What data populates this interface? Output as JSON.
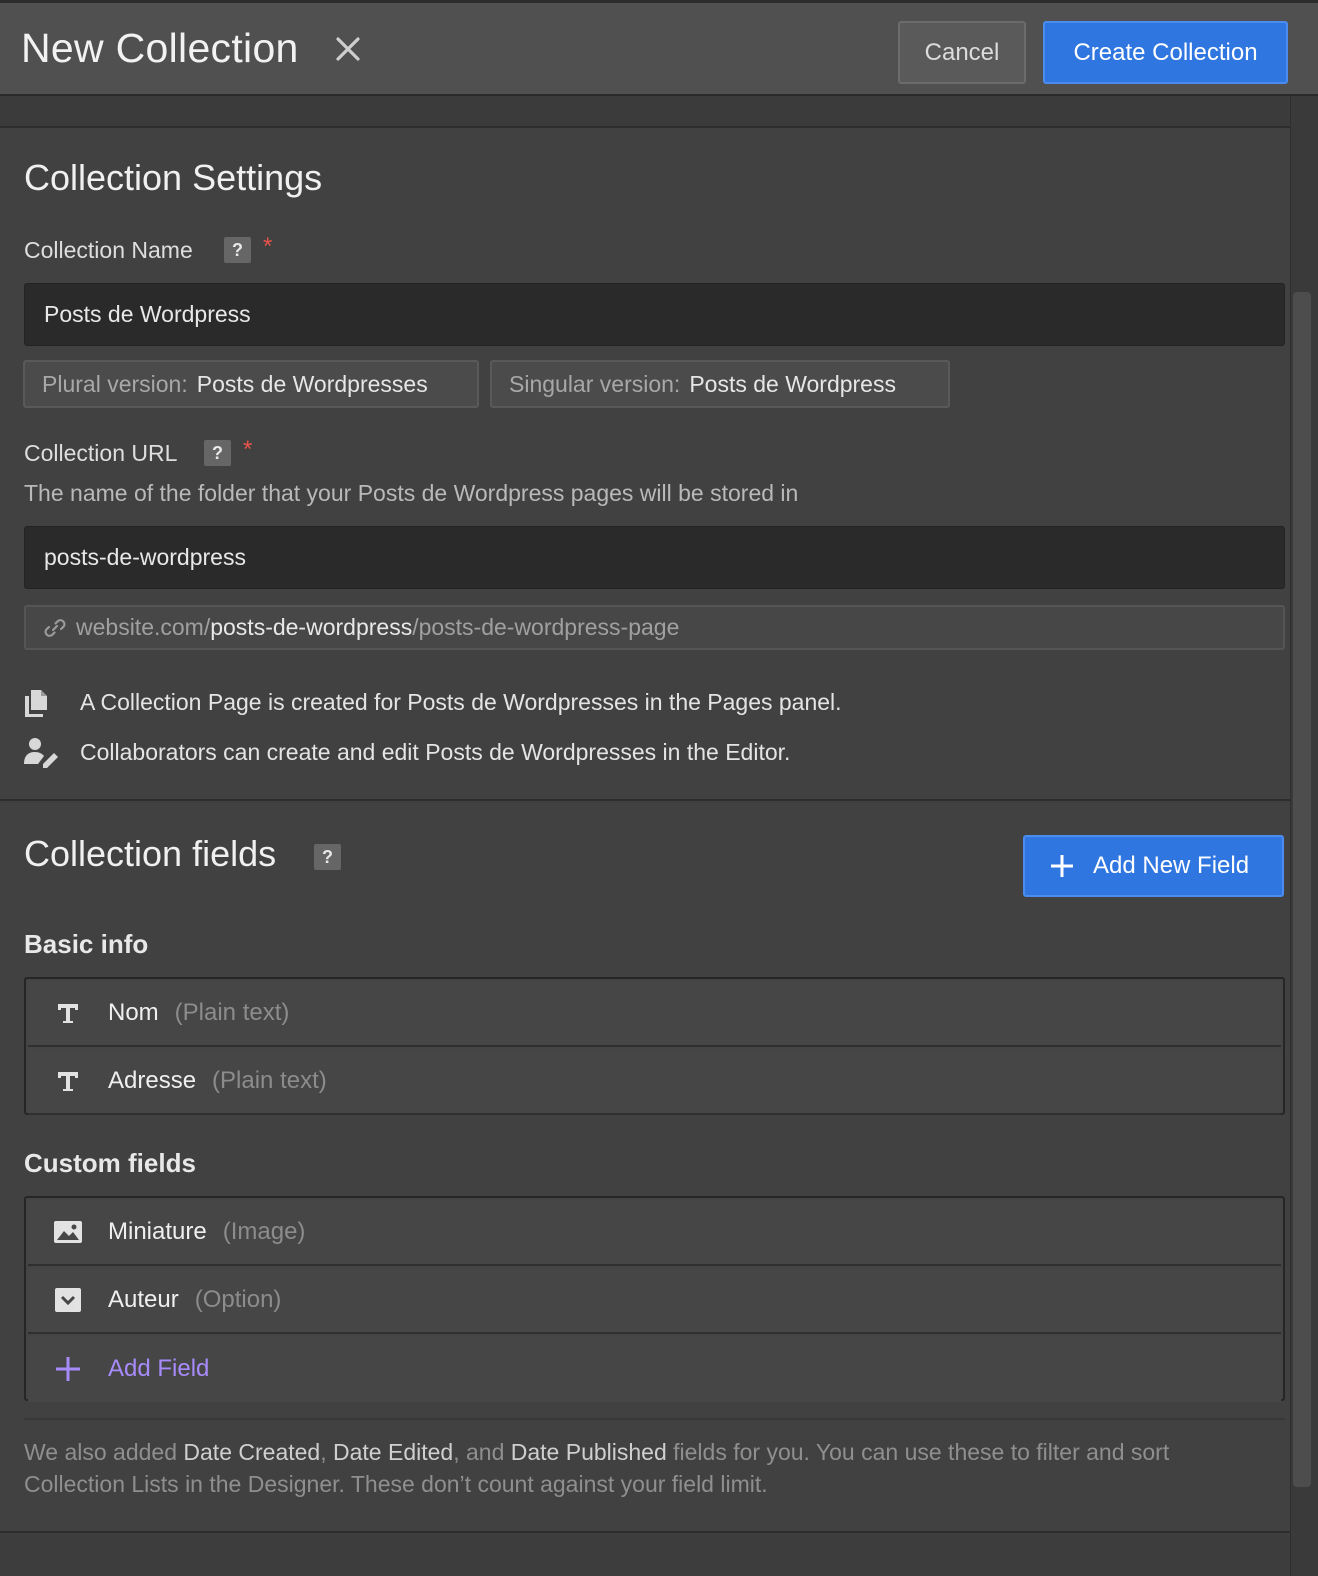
{
  "header": {
    "title": "New Collection",
    "cancel_label": "Cancel",
    "create_label": "Create Collection"
  },
  "settings": {
    "heading": "Collection Settings",
    "name_label": "Collection Name",
    "help_glyph": "?",
    "required_mark": "*",
    "name_value": "Posts de Wordpress",
    "plural_label": "Plural version:",
    "plural_value": "Posts de Wordpresses",
    "singular_label": "Singular version:",
    "singular_value": "Posts de Wordpress",
    "url_label": "Collection URL",
    "url_description": "The name of the folder that your Posts de Wordpress pages will be stored in",
    "url_value": "posts-de-wordpress",
    "url_preview": {
      "domain": "website.com/",
      "folder": "posts-de-wordpress",
      "page": "/posts-de-wordpress-page"
    },
    "info_pages": "A Collection Page is created for Posts de Wordpresses in the Pages panel.",
    "info_editor": "Collaborators can create and edit Posts de Wordpresses in the Editor."
  },
  "fields": {
    "heading": "Collection fields",
    "add_new_label": "Add New Field",
    "basic_heading": "Basic info",
    "basic": [
      {
        "name": "Nom",
        "type": "(Plain text)",
        "icon": "text-icon"
      },
      {
        "name": "Adresse",
        "type": "(Plain text)",
        "icon": "text-icon"
      }
    ],
    "custom_heading": "Custom fields",
    "custom": [
      {
        "name": "Miniature",
        "type": "(Image)",
        "icon": "image-icon"
      },
      {
        "name": "Auteur",
        "type": "(Option)",
        "icon": "option-icon"
      }
    ],
    "add_field_label": "Add Field",
    "footnote": {
      "p1": "We also added ",
      "b1": "Date Created",
      "p2": ", ",
      "b2": "Date Edited",
      "p3": ", and ",
      "b3": "Date Published",
      "p4": " fields for you. You can use these to filter and sort Collection Lists in the Designer. These don’t count against your field limit."
    }
  },
  "colors": {
    "accent": "#2f76e0",
    "add_field": "#a78bfa",
    "required": "#e9534b"
  }
}
